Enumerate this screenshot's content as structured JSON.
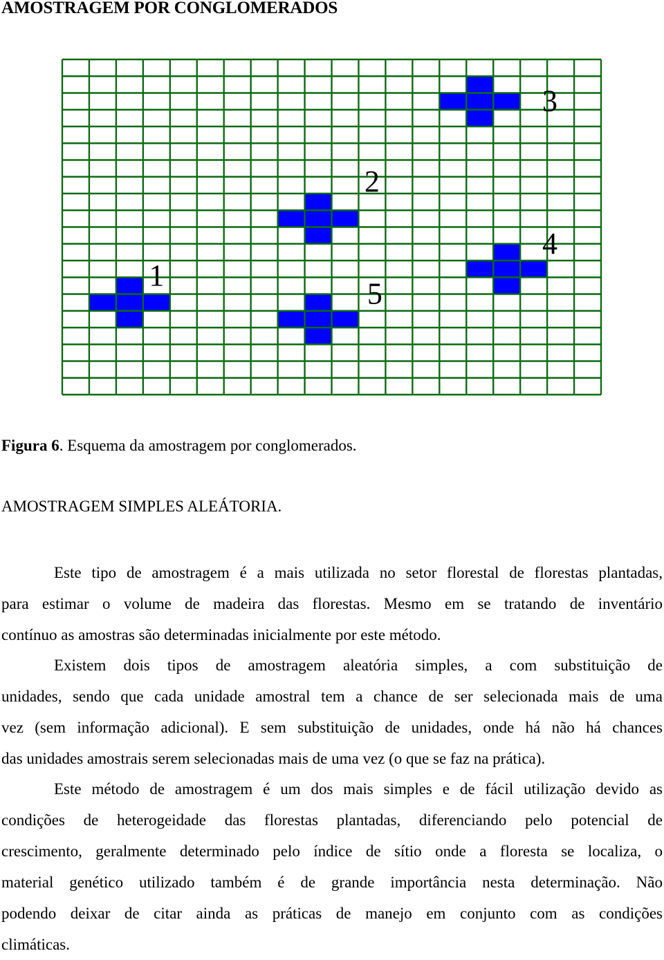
{
  "heading": "AMOSTRAGEM POR CONGLOMERADOS",
  "figure": {
    "grid": {
      "columns": 20,
      "rows": 20,
      "line_color": "#0b6a12",
      "cell_fill": "#ffffff"
    },
    "cluster_color": "#0000ff",
    "clusters": [
      {
        "label": "1",
        "center": {
          "col": 2,
          "row": 14
        }
      },
      {
        "label": "2",
        "center": {
          "col": 9,
          "row": 9
        }
      },
      {
        "label": "3",
        "center": {
          "col": 15,
          "row": 2
        }
      },
      {
        "label": "4",
        "center": {
          "col": 16,
          "row": 12
        }
      },
      {
        "label": "5",
        "center": {
          "col": 9,
          "row": 15
        }
      }
    ]
  },
  "caption": {
    "prefix": "Figura 6",
    "text": ". Esquema da amostragem por conglomerados."
  },
  "section_title": "AMOSTRAGEM SIMPLES ALEÁTORIA.",
  "paragraphs": [
    {
      "lines": [
        "Este tipo de amostragem é a mais utilizada no setor florestal de florestas plantadas,",
        "para estimar o volume de madeira das florestas. Mesmo em se tratando de inventário",
        "contínuo as amostras são determinadas inicialmente por este método."
      ]
    },
    {
      "lines": [
        "Existem dois tipos de amostragem aleatória simples, a com substituição de",
        "unidades, sendo que cada unidade amostral tem a chance de ser selecionada mais de uma",
        "vez (sem informação adicional). E sem substituição de unidades, onde há não há chances",
        "das unidades amostrais serem selecionadas mais de uma vez (o que se faz na prática)."
      ]
    },
    {
      "lines": [
        "Este método de amostragem é um dos mais simples e de fácil utilização devido as",
        "condições de heterogeidade das florestas plantadas, diferenciando pelo potencial de",
        "crescimento, geralmente determinado pelo índice de sítio onde a floresta se localiza, o",
        "material genético utilizado também é de grande importância nesta determinação. Não",
        "podendo deixar de citar ainda as práticas de manejo em conjunto com as condições",
        "climáticas."
      ]
    }
  ]
}
